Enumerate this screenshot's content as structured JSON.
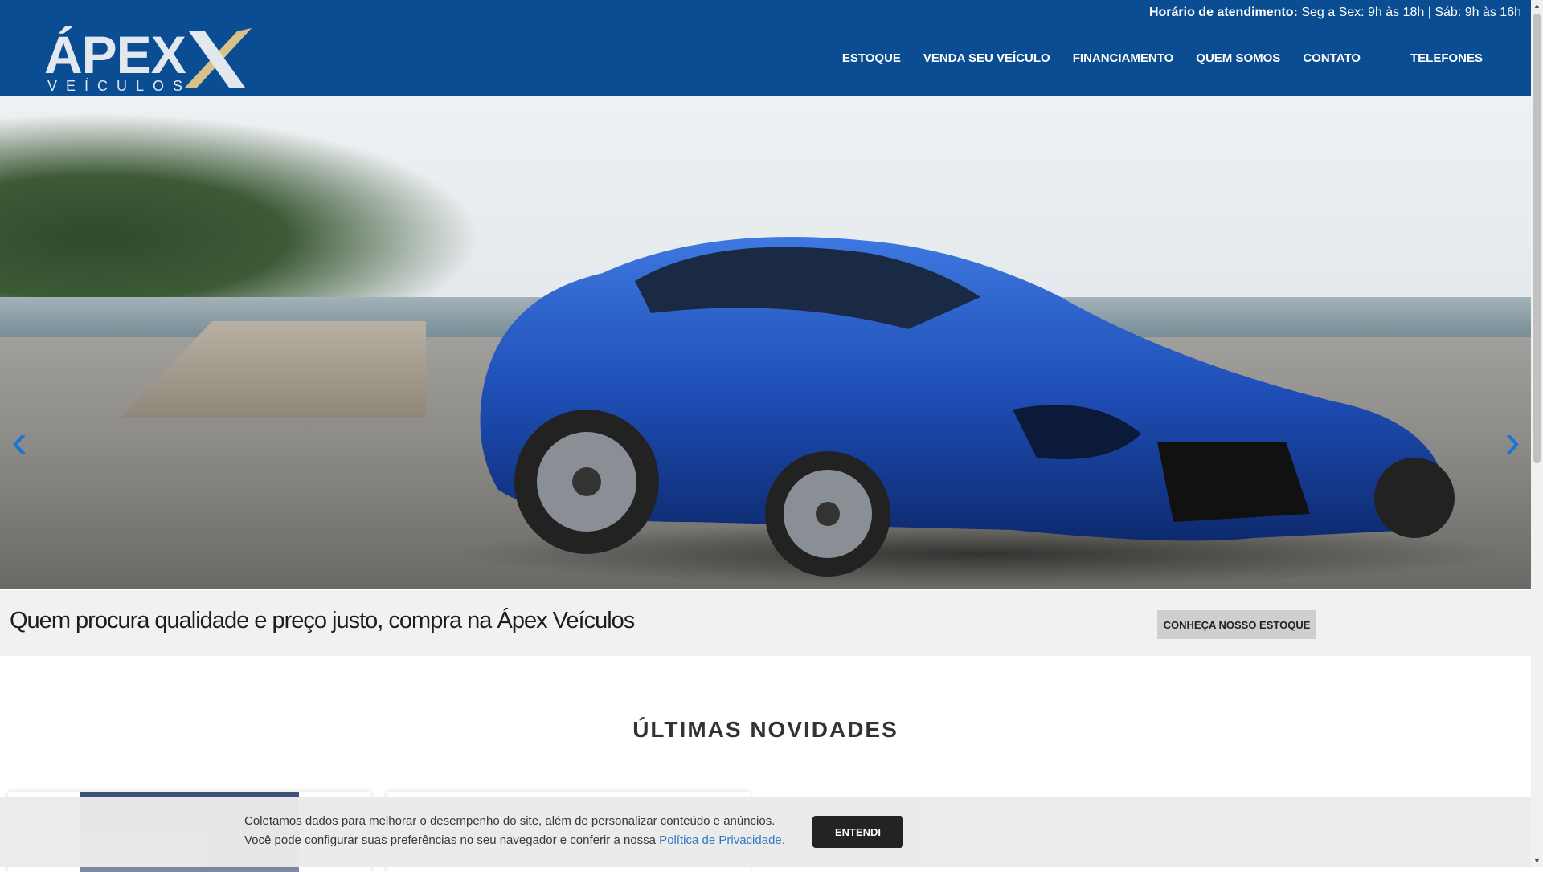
{
  "header": {
    "hours_label": "Horário de atendimento:",
    "hours_text": "Seg a Sex: 9h às 18h | Sáb: 9h às 16h",
    "logo_text": "ÁPEX",
    "logo_sub": "VEÍCULOS"
  },
  "nav": {
    "items": [
      {
        "label": "ESTOQUE"
      },
      {
        "label": "VENDA SEU VEÍCULO"
      },
      {
        "label": "FINANCIAMENTO"
      },
      {
        "label": "QUEM SOMOS"
      },
      {
        "label": "CONTATO"
      }
    ],
    "phones_icon": "",
    "phones_label": "TELEFONES",
    "phones_caret": ""
  },
  "hero": {
    "prev_arrow": "‹",
    "next_arrow": "›"
  },
  "band": {
    "tagline": "Quem procura qualidade e preço justo, compra na Ápex Veículos",
    "cta": "CONHEÇA NOSSO ESTOQUE"
  },
  "section": {
    "title": "ÚLTIMAS NOVIDADES"
  },
  "cookie": {
    "line1": "Coletamos dados para melhorar o desempenho do site, além de personalizar conteúdo e anúncios.",
    "line2": "Você pode configurar suas preferências no seu navegador e conferir a nossa ",
    "link": "Política de Privacidade.",
    "button": "ENTENDI"
  },
  "colors": {
    "header_bg": "#0a4d92",
    "arrow": "#1a73d9",
    "car_blue": "#1f4fb8"
  }
}
